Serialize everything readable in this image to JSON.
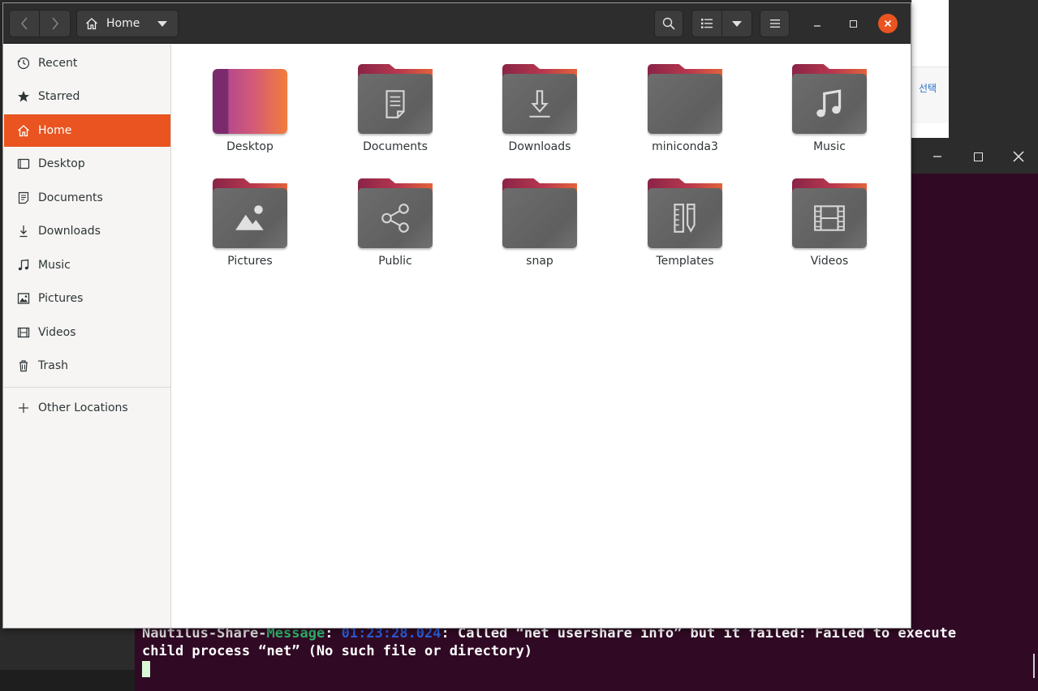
{
  "background": {
    "korean_text": "선택"
  },
  "terminal": {
    "line1_prefix": "Nautilus-Share-",
    "line1_tag": "Message",
    "line1_sep": ": ",
    "line1_time": "01:23:28.024",
    "line1_rest": ": Called “net usershare info” but it failed: Failed to execute",
    "line2": "child process “net” (No such file or directory)",
    "colors": {
      "background": "#300a24",
      "tag": "#2fb36b",
      "time": "#2a5bd6"
    }
  },
  "nautilus": {
    "path": {
      "label": "Home",
      "icon": "home-icon"
    },
    "accent": "#e95420",
    "sidebar": {
      "items": [
        {
          "label": "Recent",
          "icon": "clock-icon"
        },
        {
          "label": "Starred",
          "icon": "star-icon"
        },
        {
          "label": "Home",
          "icon": "home-icon",
          "active": true
        },
        {
          "label": "Desktop",
          "icon": "desktop-icon"
        },
        {
          "label": "Documents",
          "icon": "document-icon"
        },
        {
          "label": "Downloads",
          "icon": "download-icon"
        },
        {
          "label": "Music",
          "icon": "music-icon"
        },
        {
          "label": "Pictures",
          "icon": "picture-icon"
        },
        {
          "label": "Videos",
          "icon": "video-icon"
        },
        {
          "label": "Trash",
          "icon": "trash-icon"
        }
      ],
      "other_locations": {
        "label": "Other Locations",
        "icon": "plus-icon"
      }
    },
    "files": [
      {
        "label": "Desktop",
        "icon": "desktop-folder-icon"
      },
      {
        "label": "Documents",
        "icon": "document-icon"
      },
      {
        "label": "Downloads",
        "icon": "download-icon"
      },
      {
        "label": "miniconda3",
        "icon": "folder-icon"
      },
      {
        "label": "Music",
        "icon": "music-icon"
      },
      {
        "label": "Pictures",
        "icon": "picture-icon"
      },
      {
        "label": "Public",
        "icon": "share-icon"
      },
      {
        "label": "snap",
        "icon": "folder-icon"
      },
      {
        "label": "Templates",
        "icon": "templates-icon"
      },
      {
        "label": "Videos",
        "icon": "video-icon"
      }
    ]
  }
}
